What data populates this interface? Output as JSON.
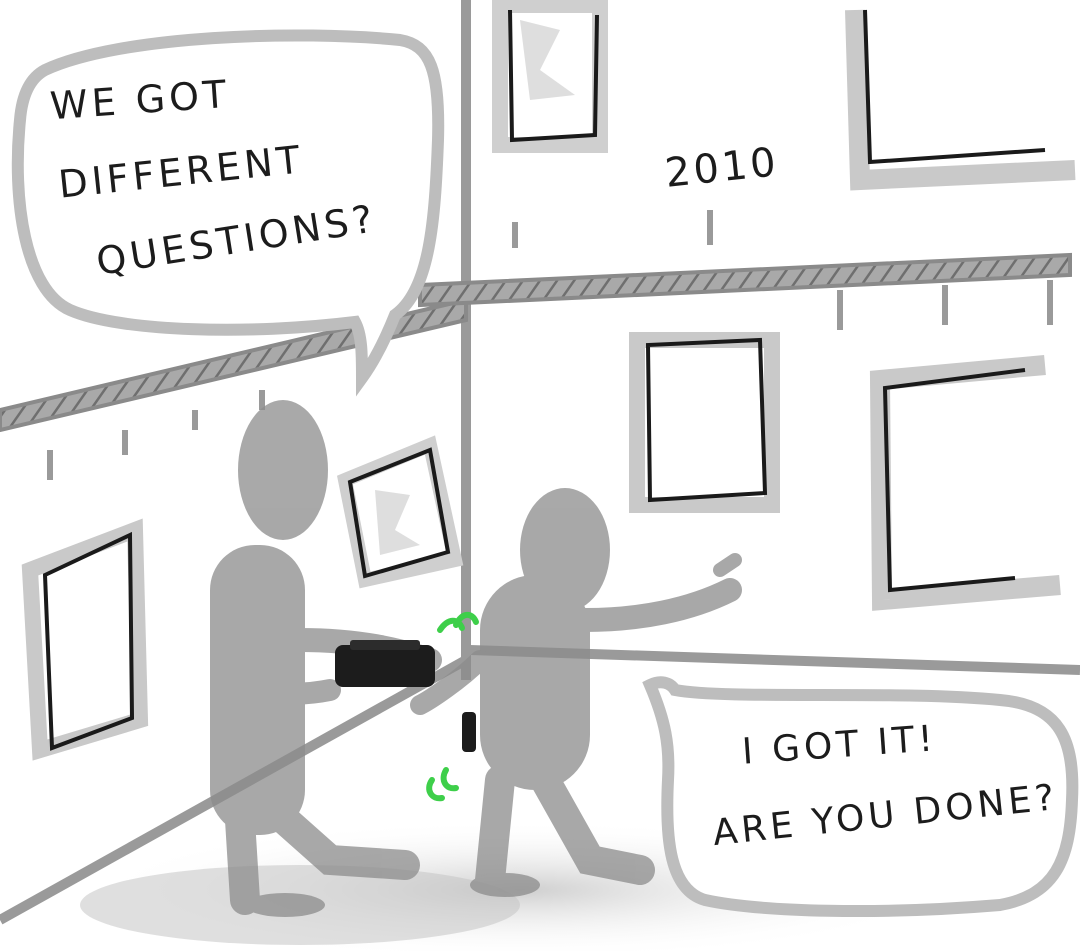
{
  "bubble_top": {
    "lines": [
      "WE GOT",
      "DIFFERENT",
      "QUESTIONS?"
    ]
  },
  "bubble_bottom": {
    "lines": [
      "I GOT IT!",
      "ARE YOU DONE?"
    ]
  },
  "timeline": {
    "year_label": "2010"
  },
  "colors": {
    "background": "#ffffff",
    "wall_gray": "#9a9a9a",
    "figure_gray": "#8c8c8c",
    "frame_line": "#1a1a1a",
    "signal_green": "#3ecf4a"
  }
}
